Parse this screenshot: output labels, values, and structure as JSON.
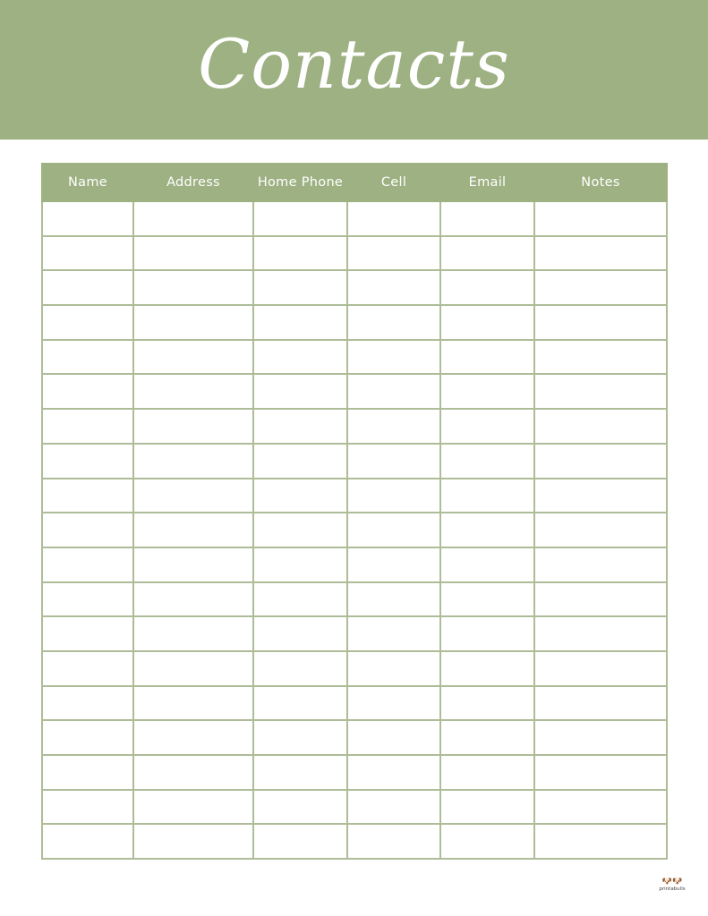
{
  "header": {
    "title": "Contacts",
    "banner_color": "#9db182"
  },
  "table": {
    "columns": [
      "Name",
      "Address",
      "Home Phone",
      "Cell",
      "Email",
      "Notes"
    ],
    "row_count": 19,
    "line_color": "#aebc98"
  },
  "footer": {
    "logo_icon": "french-bulldogs-icon",
    "logo_text": "printabulls"
  }
}
